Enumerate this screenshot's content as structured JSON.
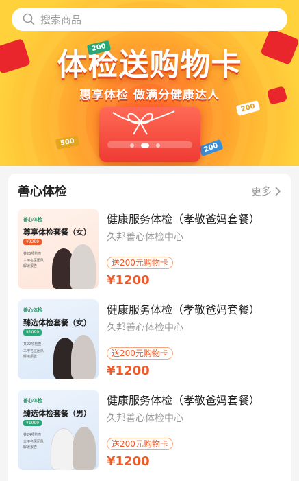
{
  "search": {
    "placeholder": "搜索商品"
  },
  "banner": {
    "title": "体检送购物卡",
    "subtitle": "惠享体检 做满分健康达人",
    "coin_labels": [
      "200",
      "500",
      "200",
      "200"
    ],
    "carousel": {
      "count": 3,
      "active_index": 1
    }
  },
  "section": {
    "title": "善心体检",
    "more_label": "更多"
  },
  "items": [
    {
      "title": "健康服务体检（孝敬爸妈套餐）",
      "provider": "久邦善心体检中心",
      "tag": "送200元购物卡",
      "price": "¥1200",
      "thumb": {
        "brand": "善心体检",
        "title": "尊享体检套餐（女）",
        "price": "¥2299",
        "features": [
          "共26项检查",
          "三甲名医团队",
          "解读报告"
        ],
        "theme": "#fde9e2",
        "accent": "#f05a28"
      }
    },
    {
      "title": "健康服务体检（孝敬爸妈套餐）",
      "provider": "久邦善心体检中心",
      "tag": "送200元购物卡",
      "price": "¥1200",
      "thumb": {
        "brand": "善心体检",
        "title": "臻选体检套餐（女）",
        "price": "¥1099",
        "features": [
          "共22项检查",
          "三甲名医团队",
          "解读报告"
        ],
        "theme": "#e3eefb",
        "accent": "#2ba676"
      }
    },
    {
      "title": "健康服务体检（孝敬爸妈套餐）",
      "provider": "久邦善心体检中心",
      "tag": "送200元购物卡",
      "price": "¥1200",
      "thumb": {
        "brand": "善心体检",
        "title": "臻选体检套餐（男）",
        "price": "¥1099",
        "features": [
          "共24项检查",
          "三甲名医团队",
          "解读报告"
        ],
        "theme": "#e3eefb",
        "accent": "#2ba676"
      }
    }
  ]
}
